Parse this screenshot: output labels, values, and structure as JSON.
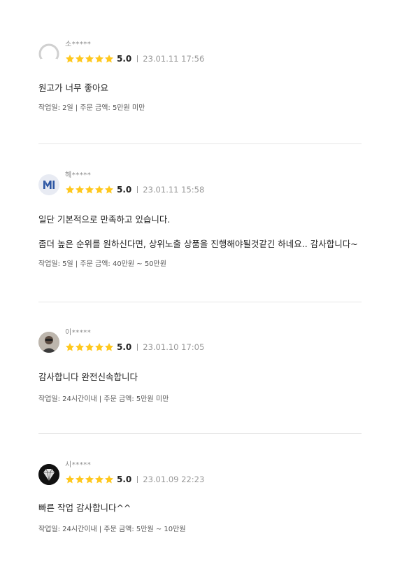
{
  "reviews": [
    {
      "nickname": "소*****",
      "score": "5.0",
      "date": "23.01.11 17:56",
      "texts": [
        "원고가 너무 좋아요"
      ],
      "detail": "작업일: 2일 | 주문 금액: 5만원 미만",
      "stars": 5
    },
    {
      "nickname": "헤*****",
      "score": "5.0",
      "date": "23.01.11 15:58",
      "texts": [
        "일단 기본적으로 만족하고 있습니다.",
        "좀더 높은 순위를 원하신다면, 상위노출 상품을 진행해야될것같긴 하네요.. 감사합니다~"
      ],
      "detail": "작업일: 5일 | 주문 금액: 40만원 ~ 50만원",
      "stars": 5
    },
    {
      "nickname": "이*****",
      "score": "5.0",
      "date": "23.01.10 17:05",
      "texts": [
        "감사합니다 완전신속합니다"
      ],
      "detail": "작업일: 24시간이내 | 주문 금액: 5만원 미만",
      "stars": 5
    },
    {
      "nickname": "시*****",
      "score": "5.0",
      "date": "23.01.09 22:23",
      "texts": [
        "빠른 작업 감사합니다^^"
      ],
      "detail": "작업일: 24시간이내 | 주문 금액: 5만원 ~ 10만원",
      "stars": 5
    }
  ],
  "colors": {
    "star": "#FFC81E",
    "divider": "#E6E6E6",
    "muted": "#999999"
  }
}
